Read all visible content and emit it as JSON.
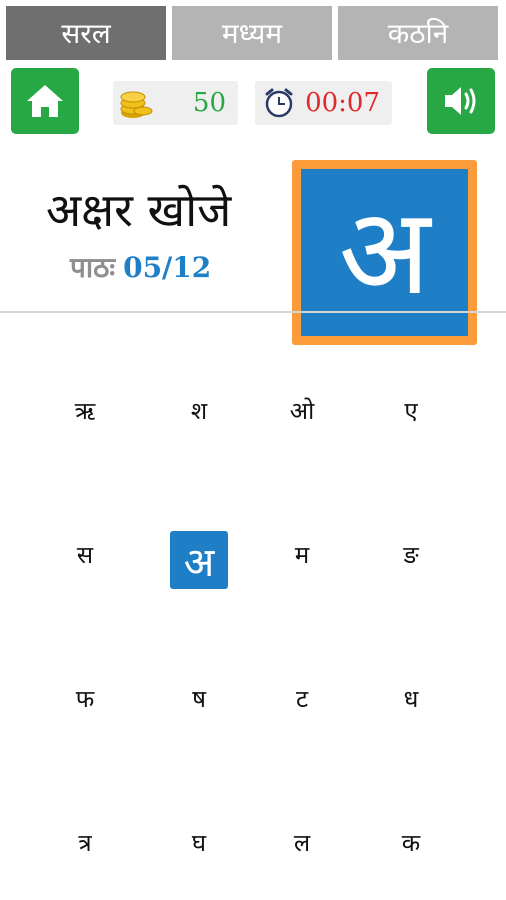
{
  "tabs": [
    {
      "label": "सरल",
      "active": true
    },
    {
      "label": "मध्यम",
      "active": false
    },
    {
      "label": "कठनि",
      "active": false
    }
  ],
  "toolbar": {
    "coins": "50",
    "timer": "00:07"
  },
  "task": {
    "title": "अक्षर खोजे",
    "lesson_label": "पाठः",
    "lesson_value": "05/12",
    "target_letter": "अ"
  },
  "grid": {
    "rows": [
      [
        "ऋ",
        "श",
        "ओ",
        "ए"
      ],
      [
        "स",
        "अ",
        "म",
        "ङ"
      ],
      [
        "फ",
        "ष",
        "ट",
        "ध"
      ],
      [
        "त्र",
        "घ",
        "ल",
        "क"
      ]
    ],
    "selected": {
      "row": 1,
      "col": 1
    }
  },
  "colors": {
    "active_tab": "#6f6f6f",
    "inactive_tab": "#b4b4b4",
    "button_green": "#28a745",
    "tile_blue": "#1f7fc6",
    "frame_orange": "#fb9b3a",
    "timer_red": "#e02a2a"
  },
  "icons": {
    "home": "home-icon",
    "coins": "coin-stack-icon",
    "timer": "alarm-clock-icon",
    "sound": "speaker-icon"
  }
}
